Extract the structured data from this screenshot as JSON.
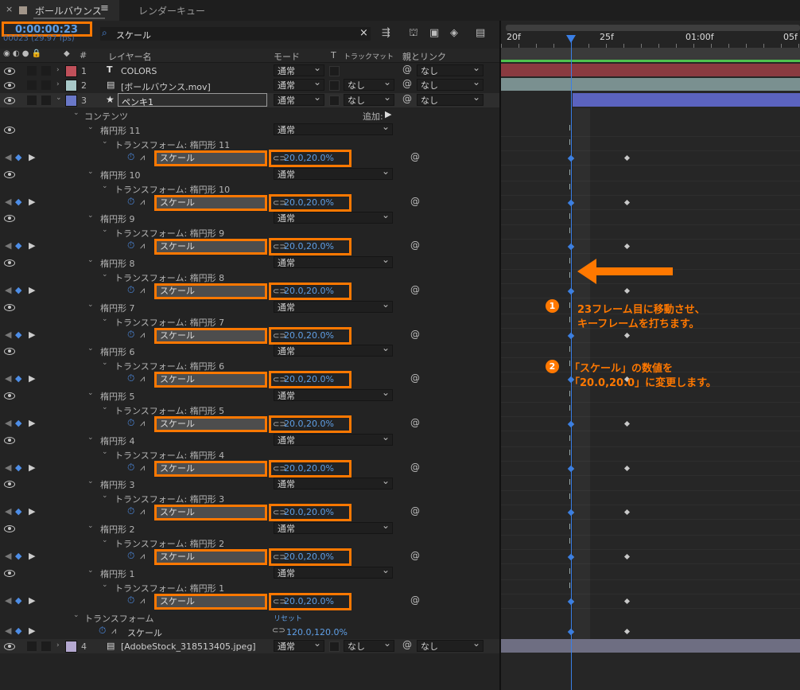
{
  "tabs": [
    {
      "label": "ボールバウンス",
      "active": true
    },
    {
      "label": "レンダーキュー",
      "active": false
    }
  ],
  "timecode": "0:00:00:23",
  "fps": "00023 (29.97 fps)",
  "search": {
    "value": "スケール"
  },
  "columns": {
    "num": "#",
    "layer_name": "レイヤー名",
    "mode": "モード",
    "t": "T",
    "trkmat": "トラックマット",
    "parent": "親とリンク"
  },
  "ruler": {
    "t0": "20f",
    "t1": "25f",
    "t2": "01:00f",
    "t3": "05f"
  },
  "layers": [
    {
      "num": "1",
      "name": "COLORS",
      "color": "#c0505a",
      "mode": "通常",
      "trk": "",
      "parent": "なし"
    },
    {
      "num": "2",
      "name": "[ボールバウンス.mov]",
      "color": "#a8c8c8",
      "mode": "通常",
      "trk": "なし",
      "parent": "なし"
    },
    {
      "num": "3",
      "name": "ペンキ1",
      "color": "#6a78c8",
      "mode": "通常",
      "trk": "なし",
      "parent": "なし"
    },
    {
      "num": "4",
      "name": "[AdobeStock_318513405.jpeg]",
      "color": "#b4a8d0",
      "mode": "通常",
      "trk": "なし",
      "parent": "なし"
    }
  ],
  "contents": {
    "label": "コンテンツ",
    "add": "追加:"
  },
  "shapes": [
    {
      "name": "楕円形 11",
      "tf": "トランスフォーム: 楕円形 11"
    },
    {
      "name": "楕円形 10",
      "tf": "トランスフォーム: 楕円形 10"
    },
    {
      "name": "楕円形 9",
      "tf": "トランスフォーム: 楕円形 9"
    },
    {
      "name": "楕円形 8",
      "tf": "トランスフォーム: 楕円形 8"
    },
    {
      "name": "楕円形 7",
      "tf": "トランスフォーム: 楕円形 7"
    },
    {
      "name": "楕円形 6",
      "tf": "トランスフォーム: 楕円形 6"
    },
    {
      "name": "楕円形 5",
      "tf": "トランスフォーム: 楕円形 5"
    },
    {
      "name": "楕円形 4",
      "tf": "トランスフォーム: 楕円形 4"
    },
    {
      "name": "楕円形 3",
      "tf": "トランスフォーム: 楕円形 3"
    },
    {
      "name": "楕円形 2",
      "tf": "トランスフォーム: 楕円形 2"
    },
    {
      "name": "楕円形 1",
      "tf": "トランスフォーム: 楕円形 1"
    }
  ],
  "shape_mode": "通常",
  "scale_label": "スケール",
  "scale_value": "20.0,20.0%",
  "layer_transform": {
    "label": "トランスフォーム",
    "reset": "リセット",
    "scale_label": "スケール",
    "scale_value": "120.0,120.0%"
  },
  "annotations": {
    "step1_num": "1",
    "step1_line1": "23フレーム目に移動させ、",
    "step1_line2": "キーフレームを打ちます。",
    "step2_num": "2",
    "step2_line1": "「スケール」の数値を",
    "step2_line2": "「20.0,20.0」に変更します。"
  },
  "colors": {
    "accent": "#ff7800",
    "playhead": "#3a7fe6",
    "value_blue": "#5f9fe6"
  }
}
